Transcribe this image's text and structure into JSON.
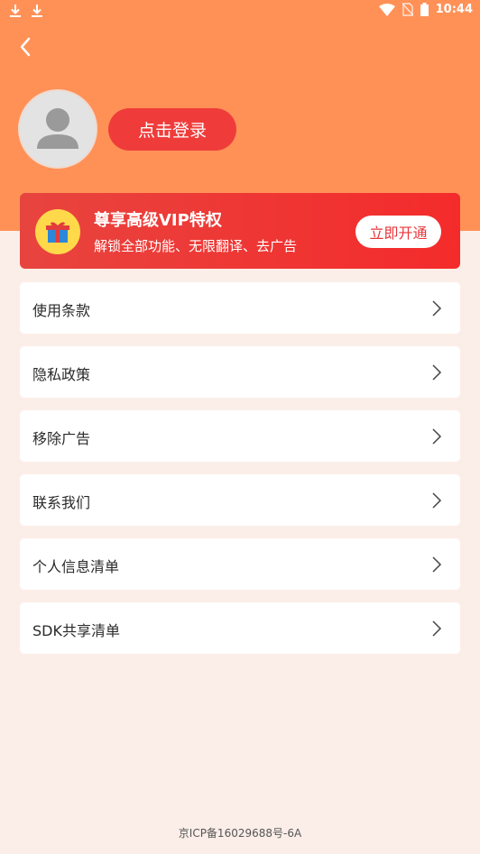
{
  "status_bar": {
    "time": "10:44",
    "left_icons": [
      "download-icon",
      "download-icon"
    ],
    "right_icons": [
      "wifi-icon",
      "no-sim-icon",
      "battery-icon"
    ]
  },
  "header": {
    "background_color": "#ff9157",
    "back_icon": "chevron-left-icon"
  },
  "profile": {
    "avatar_icon": "default-avatar-icon",
    "login_label": "点击登录"
  },
  "vip": {
    "icon": "gift-icon",
    "title": "尊享高级VIP特权",
    "subtitle": "解锁全部功能、无限翻译、去广告",
    "button_label": "立即开通",
    "accent_color": "#ef3c3a"
  },
  "menu": {
    "items": [
      {
        "label": "使用条款"
      },
      {
        "label": "隐私政策"
      },
      {
        "label": "移除广告"
      },
      {
        "label": "联系我们"
      },
      {
        "label": "个人信息清单"
      },
      {
        "label": "SDK共享清单"
      }
    ]
  },
  "footer": {
    "icp": "京ICP备16029688号-6A"
  }
}
